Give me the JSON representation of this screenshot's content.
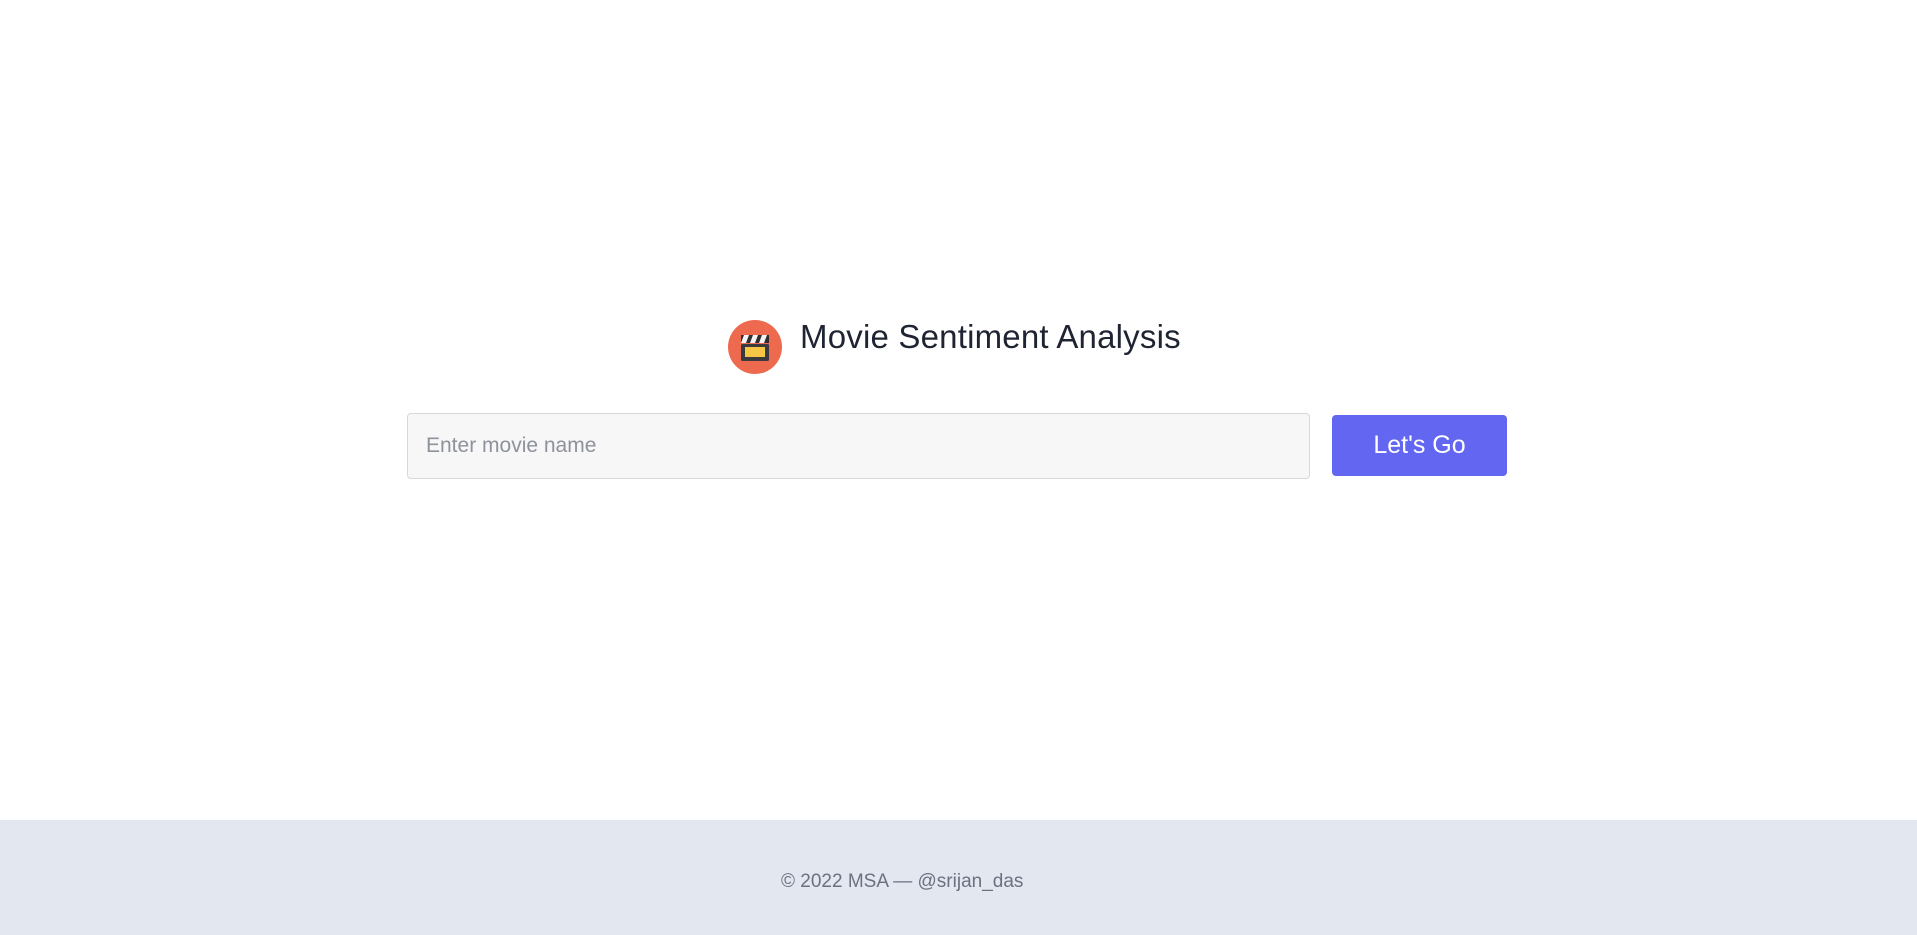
{
  "header": {
    "title": "Movie Sentiment Analysis",
    "logo_icon": "clapperboard-icon",
    "logo_color": "#ee6a4e"
  },
  "search": {
    "placeholder": "Enter movie name",
    "value": "",
    "button_label": "Let's Go",
    "button_color": "#6366f1"
  },
  "footer": {
    "text": "© 2022 MSA — @srijan_das",
    "background": "#e2e7f0"
  }
}
